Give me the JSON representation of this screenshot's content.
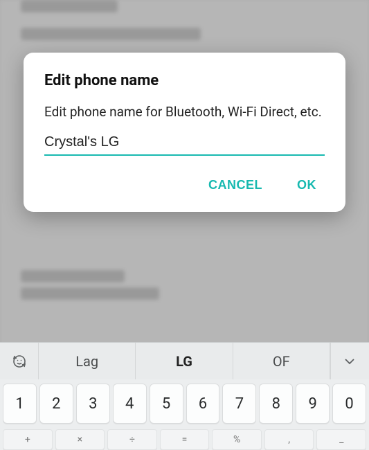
{
  "dialog": {
    "title": "Edit phone name",
    "description": "Edit phone name for Bluetooth, Wi-Fi Direct, etc.",
    "input_value": "Crystal's LG",
    "cancel_label": "CANCEL",
    "ok_label": "OK"
  },
  "keyboard": {
    "suggestions": {
      "left": "Lag",
      "center": "LG",
      "right": "OF"
    },
    "numbers": [
      "1",
      "2",
      "3",
      "4",
      "5",
      "6",
      "7",
      "8",
      "9",
      "0"
    ],
    "symbols": [
      "+",
      "×",
      "÷",
      "=",
      "%",
      ",",
      "_"
    ]
  }
}
